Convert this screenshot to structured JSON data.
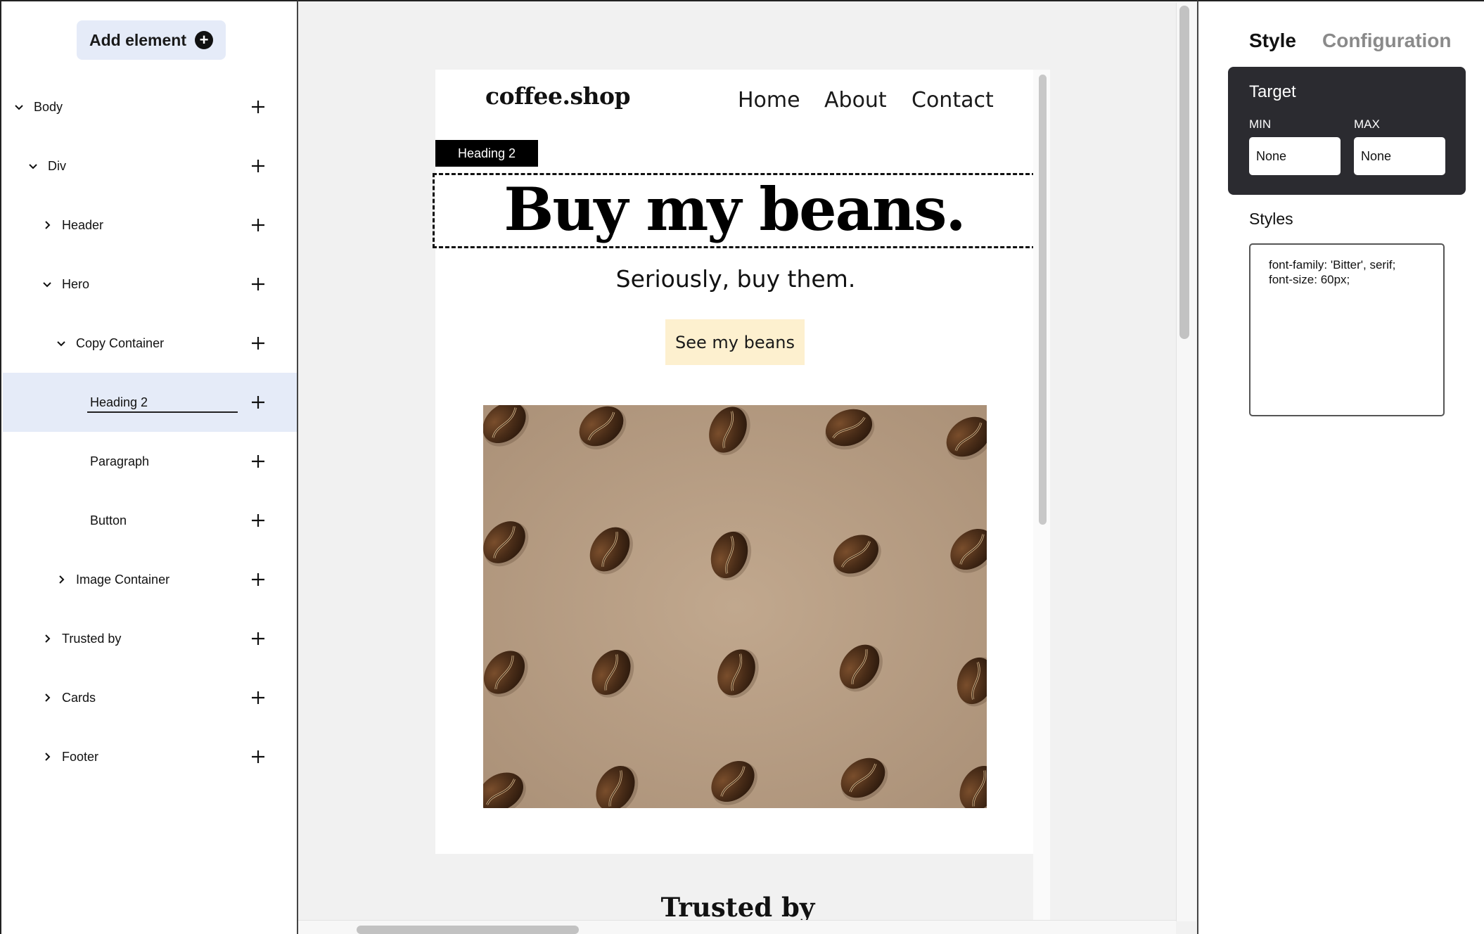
{
  "left_panel": {
    "add_element_label": "Add element",
    "tree": [
      {
        "label": "Body",
        "expanded": true
      },
      {
        "label": "Div",
        "expanded": true
      },
      {
        "label": "Header",
        "expanded": false
      },
      {
        "label": "Hero",
        "expanded": true
      },
      {
        "label": "Copy Container",
        "expanded": true
      },
      {
        "label": "Heading 2",
        "selected": true
      },
      {
        "label": "Paragraph"
      },
      {
        "label": "Button"
      },
      {
        "label": "Image Container",
        "expanded": false
      },
      {
        "label": "Trusted by",
        "expanded": false
      },
      {
        "label": "Cards",
        "expanded": false
      },
      {
        "label": "Footer",
        "expanded": false
      }
    ]
  },
  "preview": {
    "logo": "coffee.shop",
    "nav": [
      "Home",
      "About",
      "Contact"
    ],
    "selection_tag": "Heading 2",
    "hero_heading": "Buy my beans.",
    "hero_subtitle": "Seriously, buy them.",
    "hero_button": "See my beans",
    "hero_image_alt": "coffee beans",
    "next_section_heading": "Trusted by"
  },
  "right_panel": {
    "tabs": [
      "Style",
      "Configuration"
    ],
    "active_tab": "Style",
    "target": {
      "title": "Target",
      "min_label": "MIN",
      "max_label": "MAX",
      "min_value": "None",
      "max_value": "None"
    },
    "styles_label": "Styles",
    "styles_value": "font-family: 'Bitter', serif;\nfont-size: 60px;"
  },
  "colors": {
    "selection_bg": "#e5ebf8",
    "button_bg": "#fdf0cf",
    "target_panel_bg": "#2b2b30",
    "canvas_bg": "#f1f1f1"
  }
}
